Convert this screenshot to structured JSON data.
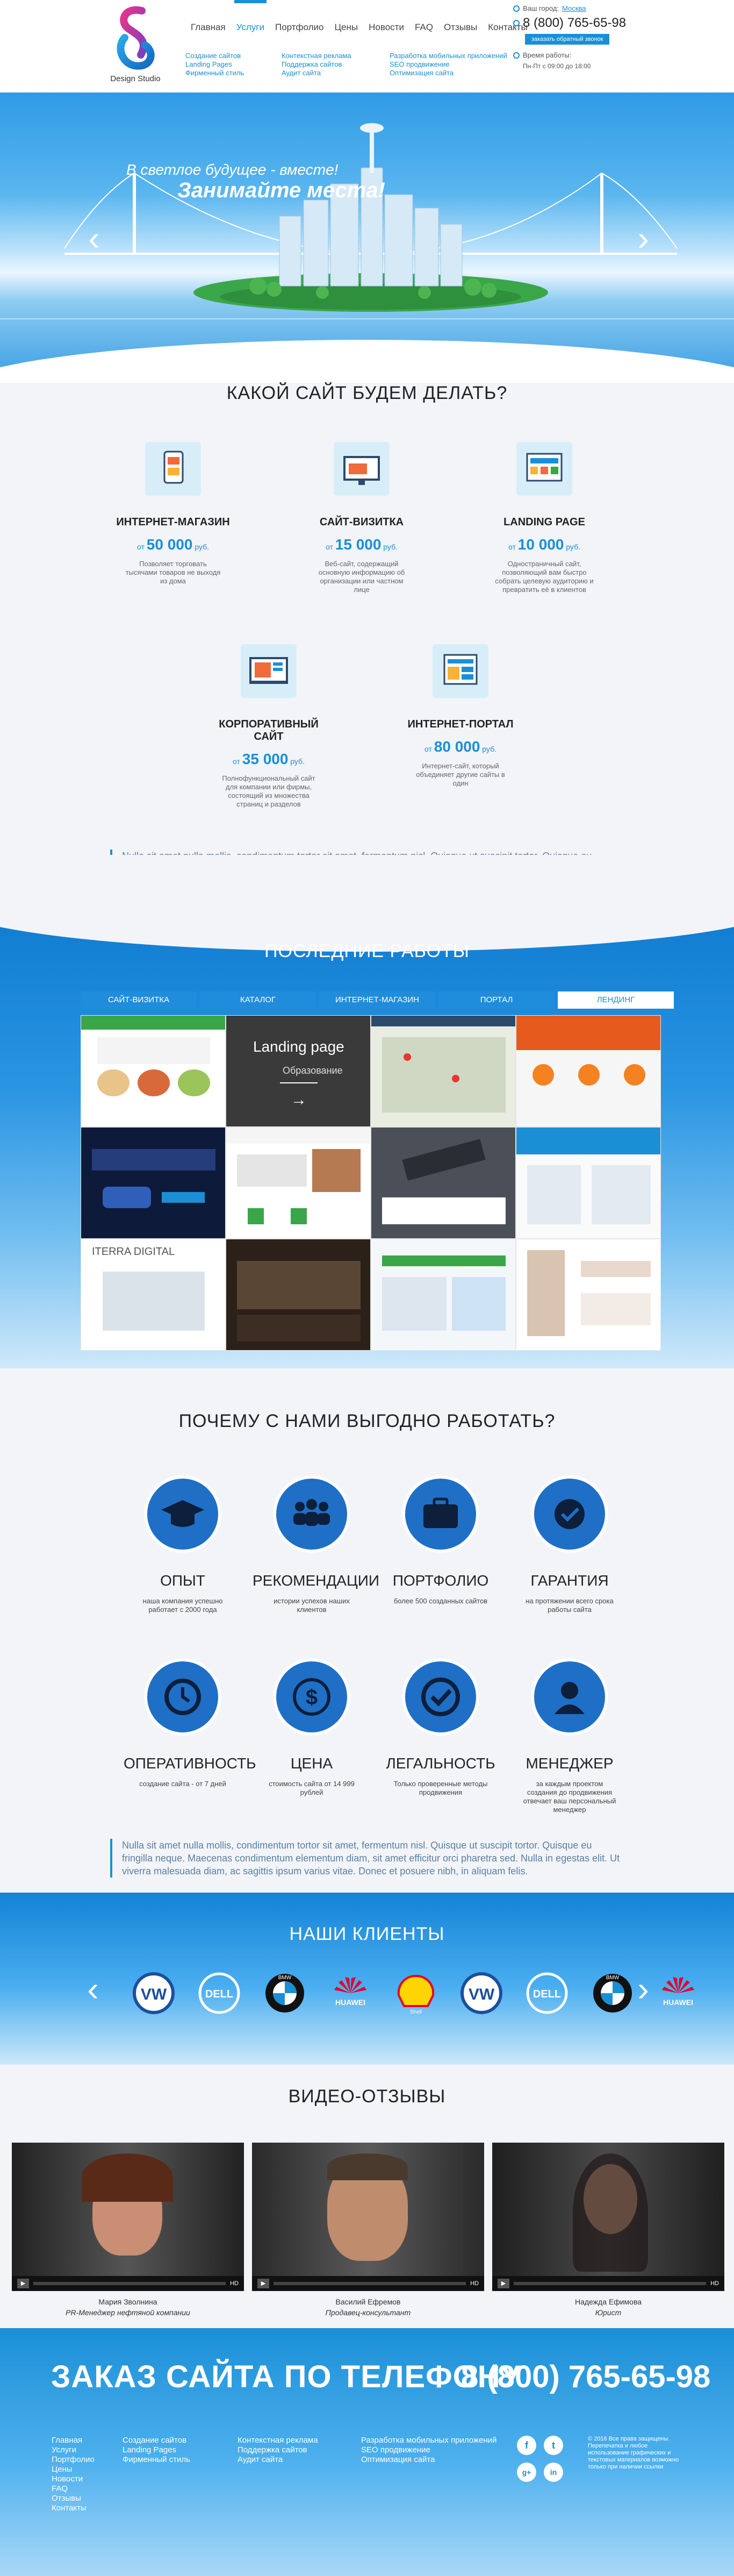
{
  "header": {
    "logo_text": "Design Studio",
    "nav": [
      "Главная",
      "Услуги",
      "Портфолио",
      "Цены",
      "Новости",
      "FAQ",
      "Отзывы",
      "Контакты"
    ],
    "submenu_col1": [
      "Создание сайтов",
      "Landing Pages",
      "Фирменный стиль"
    ],
    "submenu_col2": [
      "Контекстная реклама",
      "Поддержка сайтов",
      "Аудит сайта"
    ],
    "submenu_col3": [
      "Разработка мобильных приложений",
      "SEO продвижение",
      "Оптимизация сайта"
    ],
    "city_label": "Ваш город:",
    "city": "Москва",
    "phone": "8 (800) 765-65-98",
    "callback": "заказать обратный звонок",
    "hours_label": "Время работы:",
    "hours": "Пн-Пт с 09:00 до 18:00"
  },
  "hero": {
    "line1": "В светлое будущее - вместе!",
    "line2": "Занимайте места!"
  },
  "services": {
    "title": "КАКОЙ САЙТ БУДЕМ ДЕЛАТЬ?",
    "price_prefix": "от",
    "currency": "руб.",
    "items": [
      {
        "name": "ИНТЕРНЕТ-МАГАЗИН",
        "price": "50 000",
        "desc": "Позволяет торговать тысячами товаров не выходя из дома"
      },
      {
        "name": "САЙТ-ВИЗИТКА",
        "price": "15 000",
        "desc": "Веб-сайт, содержащий основную информацию об организации или частном лице"
      },
      {
        "name": "LANDING PAGE",
        "price": "10 000",
        "desc": "Одностраничный сайт, позволяющий вам быстро собрать целевую аудиторию и превратить её в клиентов"
      },
      {
        "name": "КОРПОРАТИВНЫЙ САЙТ",
        "price": "35 000",
        "desc": "Полнофункциональный сайт для компании или фирмы, состоящий из множества страниц и разделов"
      },
      {
        "name": "ИНТЕРНЕТ-ПОРТАЛ",
        "price": "80 000",
        "desc": "Интернет-сайт, который объединяет другие сайты в один"
      }
    ]
  },
  "quote_text": "Nulla sit amet nulla mollis, condimentum tortor sit amet, fermentum nisl. Quisque ut suscipit tortor. Quisque eu fringilla neque. Maecenas condimentum elementum diam, sit amet efficitur orci pharetra sed. Nulla in egestas elit. Ut viverra malesuada diam, ac sagittis ipsum varius vitae. Donec et posuere nibh, in aliquam felis.",
  "works": {
    "title": "ПОСЛЕДНИЕ РАБОТЫ",
    "tabs": [
      "САЙТ-ВИЗИТКА",
      "КАТАЛОГ",
      "ИНТЕРНЕТ-МАГАЗИН",
      "ПОРТАЛ",
      "ЛЕНДИНГ"
    ],
    "overlay_title": "Landing page",
    "overlay_sub": "Образование",
    "thumb4_text": "ITERRA DIGITAL"
  },
  "benefits": {
    "title": "ПОЧЕМУ С НАМИ ВЫГОДНО РАБОТАТЬ?",
    "items": [
      {
        "name": "ОПЫТ",
        "desc": "наша компания успешно работает с 2000 года"
      },
      {
        "name": "РЕКОМЕНДАЦИИ",
        "desc": "истории успехов наших клиентов"
      },
      {
        "name": "ПОРТФОЛИО",
        "desc": "более 500 созданных сайтов"
      },
      {
        "name": "ГАРАНТИЯ",
        "desc": "на протяжении всего срока работы сайта"
      },
      {
        "name": "ОПЕРАТИВНОСТЬ",
        "desc": "создание сайта - от 7 дней"
      },
      {
        "name": "ЦЕНА",
        "desc": "стоимость сайта от 14 999 рублей"
      },
      {
        "name": "ЛЕГАЛЬНОСТЬ",
        "desc": "Только проверенные методы продвижения"
      },
      {
        "name": "МЕНЕДЖЕР",
        "desc": "за каждым проектом создания до продвижения отвечает ваш персональный менеджер"
      }
    ]
  },
  "clients": {
    "title": "НАШИ КЛИЕНТЫ",
    "logos": [
      "VW",
      "DELL",
      "BMW",
      "HUAWEI",
      "Shell",
      "VW",
      "DELL",
      "BMW",
      "HUAWEI"
    ]
  },
  "videos": {
    "title": "ВИДЕО-ОТЗЫВЫ",
    "items": [
      {
        "name": "Мария Зволнина",
        "role": "PR-Менеджер нефтяной компании",
        "hd": "HD"
      },
      {
        "name": "Василий Ефремов",
        "role": "Продавец-консультант",
        "hd": "HD"
      },
      {
        "name": "Надежда Ефимова",
        "role": "Юрист",
        "hd": "HD"
      }
    ]
  },
  "footer": {
    "order": "ЗАКАЗ САЙТА ПО ТЕЛЕФОНУ",
    "phone": "8 (800) 765-65-98",
    "nav": [
      "Главная",
      "Услуги",
      "Портфолио",
      "Цены",
      "Новости",
      "FAQ",
      "Отзывы",
      "Контакты"
    ],
    "col1": [
      "Создание сайтов",
      "Landing Pages",
      "Фирменный стиль"
    ],
    "col2": [
      "Контекстная реклама",
      "Поддержка сайтов",
      "Аудит сайта"
    ],
    "col3": [
      "Разработка мобильных приложений",
      "SEO продвижение",
      "Оптимизация сайта"
    ],
    "social": [
      "f",
      "t",
      "g+",
      "in"
    ],
    "copyright": "© 2016 Все права защищены. Перепечатка и любое использование графических и текстовых материалов возможно только при наличии ссылки"
  },
  "colors": {
    "accent": "#1a8fd6",
    "dark_blue": "#1f6fc6"
  }
}
